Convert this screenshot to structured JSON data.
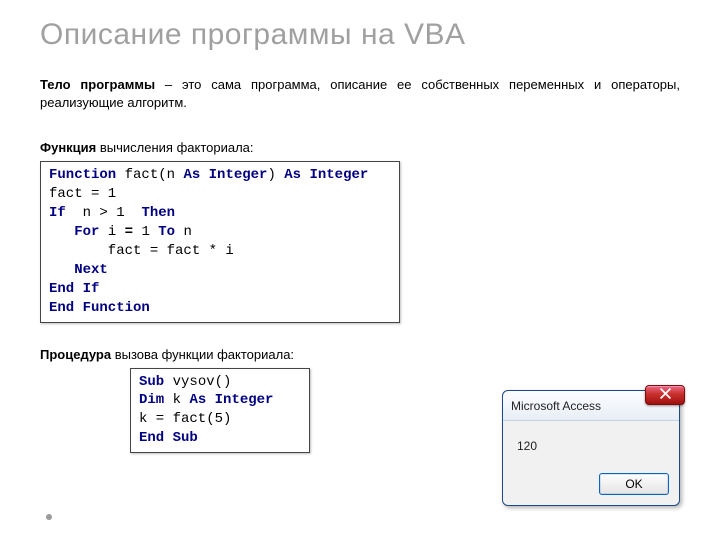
{
  "title": "Описание программы на VBA",
  "intro": {
    "bold": "Тело программы",
    "rest": " – это сама программа, описание ее собственных переменных и операторы, реализующие алгоритм."
  },
  "func_label": {
    "bold": "Функция",
    "rest": " вычисления факториала:"
  },
  "proc_label": {
    "bold": "Процедура",
    "rest": " вызова функции факториала:"
  },
  "code_func": {
    "l1a": "Function",
    "l1b": " fact(n ",
    "l1c": "As Integer",
    "l1d": ") ",
    "l1e": "As Integer",
    "l2": "fact = 1",
    "l3a": "If",
    "l3b": "  n > 1  ",
    "l3c": "Then",
    "l4a": "   For",
    "l4b": " i ",
    "l4c": "=",
    "l4d": " 1 ",
    "l4e": "To",
    "l4f": " n",
    "l5": "       fact = fact * i",
    "l6": "   Next",
    "l7": "End If",
    "l8": "End Function"
  },
  "code_proc": {
    "l1a": "Sub",
    "l1b": " vysov()",
    "l2a": "Dim",
    "l2b": " k ",
    "l2c": "As Integer",
    "l3": "k = fact(5)",
    "l4": "End Sub"
  },
  "msgbox": {
    "title": "Microsoft Access",
    "body": "120",
    "ok": "OK"
  }
}
